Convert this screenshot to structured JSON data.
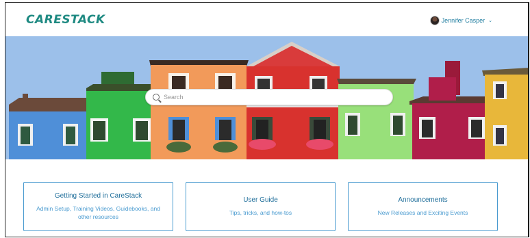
{
  "header": {
    "logo": "CARESTACK",
    "user_name": "Jennifer Casper",
    "caret": "⌄"
  },
  "search": {
    "placeholder": "Search"
  },
  "cards": [
    {
      "title": "Getting Started in CareStack",
      "desc": "Admin Setup, Training Videos, Guidebooks, and other resources"
    },
    {
      "title": "User Guide",
      "desc": "Tips, tricks, and how-tos"
    },
    {
      "title": "Announcements",
      "desc": "New Releases and Exciting Events"
    }
  ],
  "colors": {
    "brand": "#1f8a82",
    "link": "#1f6e9a",
    "card_border": "#4a9bd0"
  }
}
